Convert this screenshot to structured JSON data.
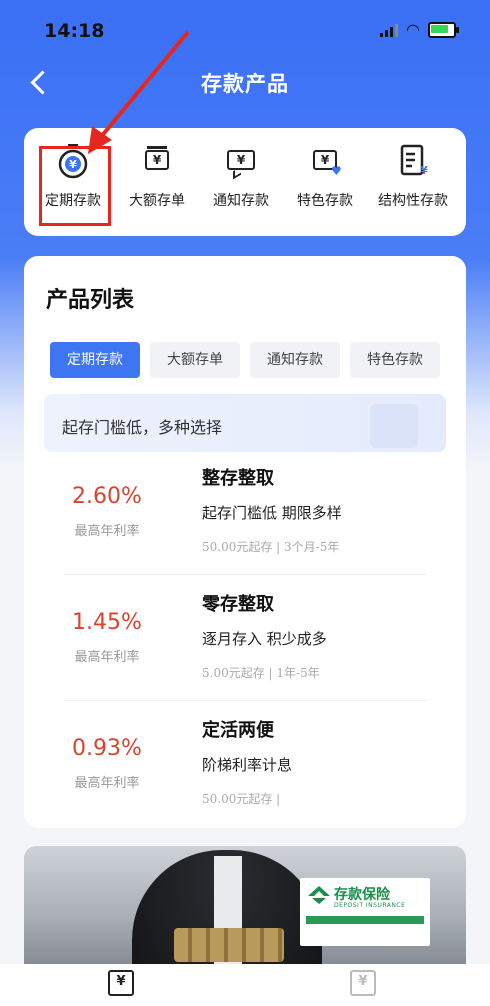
{
  "status_bar": {
    "time": "14:18"
  },
  "navbar": {
    "title": "存款产品"
  },
  "categories": [
    {
      "label": "定期存款",
      "icon": "timer-yuan-icon"
    },
    {
      "label": "大额存单",
      "icon": "certificate-yuan-icon"
    },
    {
      "label": "通知存款",
      "icon": "message-yuan-icon"
    },
    {
      "label": "特色存款",
      "icon": "heart-yuan-icon"
    },
    {
      "label": "结构性存款",
      "icon": "list-yuan-icon"
    }
  ],
  "product_list": {
    "title": "产品列表",
    "tabs": [
      "定期存款",
      "大额存单",
      "通知存款",
      "特色存款"
    ],
    "active_tab": "定期存款",
    "promo": "起存门槛低，多种选择",
    "products": [
      {
        "rate": "2.60%",
        "rate_label": "最高年利率",
        "name": "整存整取",
        "desc": "起存门槛低 期限多样",
        "meta": "50.00元起存 | 3个月-5年"
      },
      {
        "rate": "1.45%",
        "rate_label": "最高年利率",
        "name": "零存整取",
        "desc": "逐月存入 积少成多",
        "meta": "5.00元起存 | 1年-5年"
      },
      {
        "rate": "0.93%",
        "rate_label": "最高年利率",
        "name": "定活两便",
        "desc": "阶梯利率计息",
        "meta": "50.00元起存 |"
      }
    ]
  },
  "banner": {
    "insurance_title": "存款保险",
    "insurance_subtitle": "DEPOSIT INSURANCE"
  },
  "tabbar": {
    "items": [
      {
        "icon": "yuan-transfer-icon"
      },
      {
        "icon": "yuan-icon"
      }
    ]
  },
  "colors": {
    "primary": "#3d75f2",
    "rate": "#d8452f",
    "highlight": "#e5281f"
  }
}
